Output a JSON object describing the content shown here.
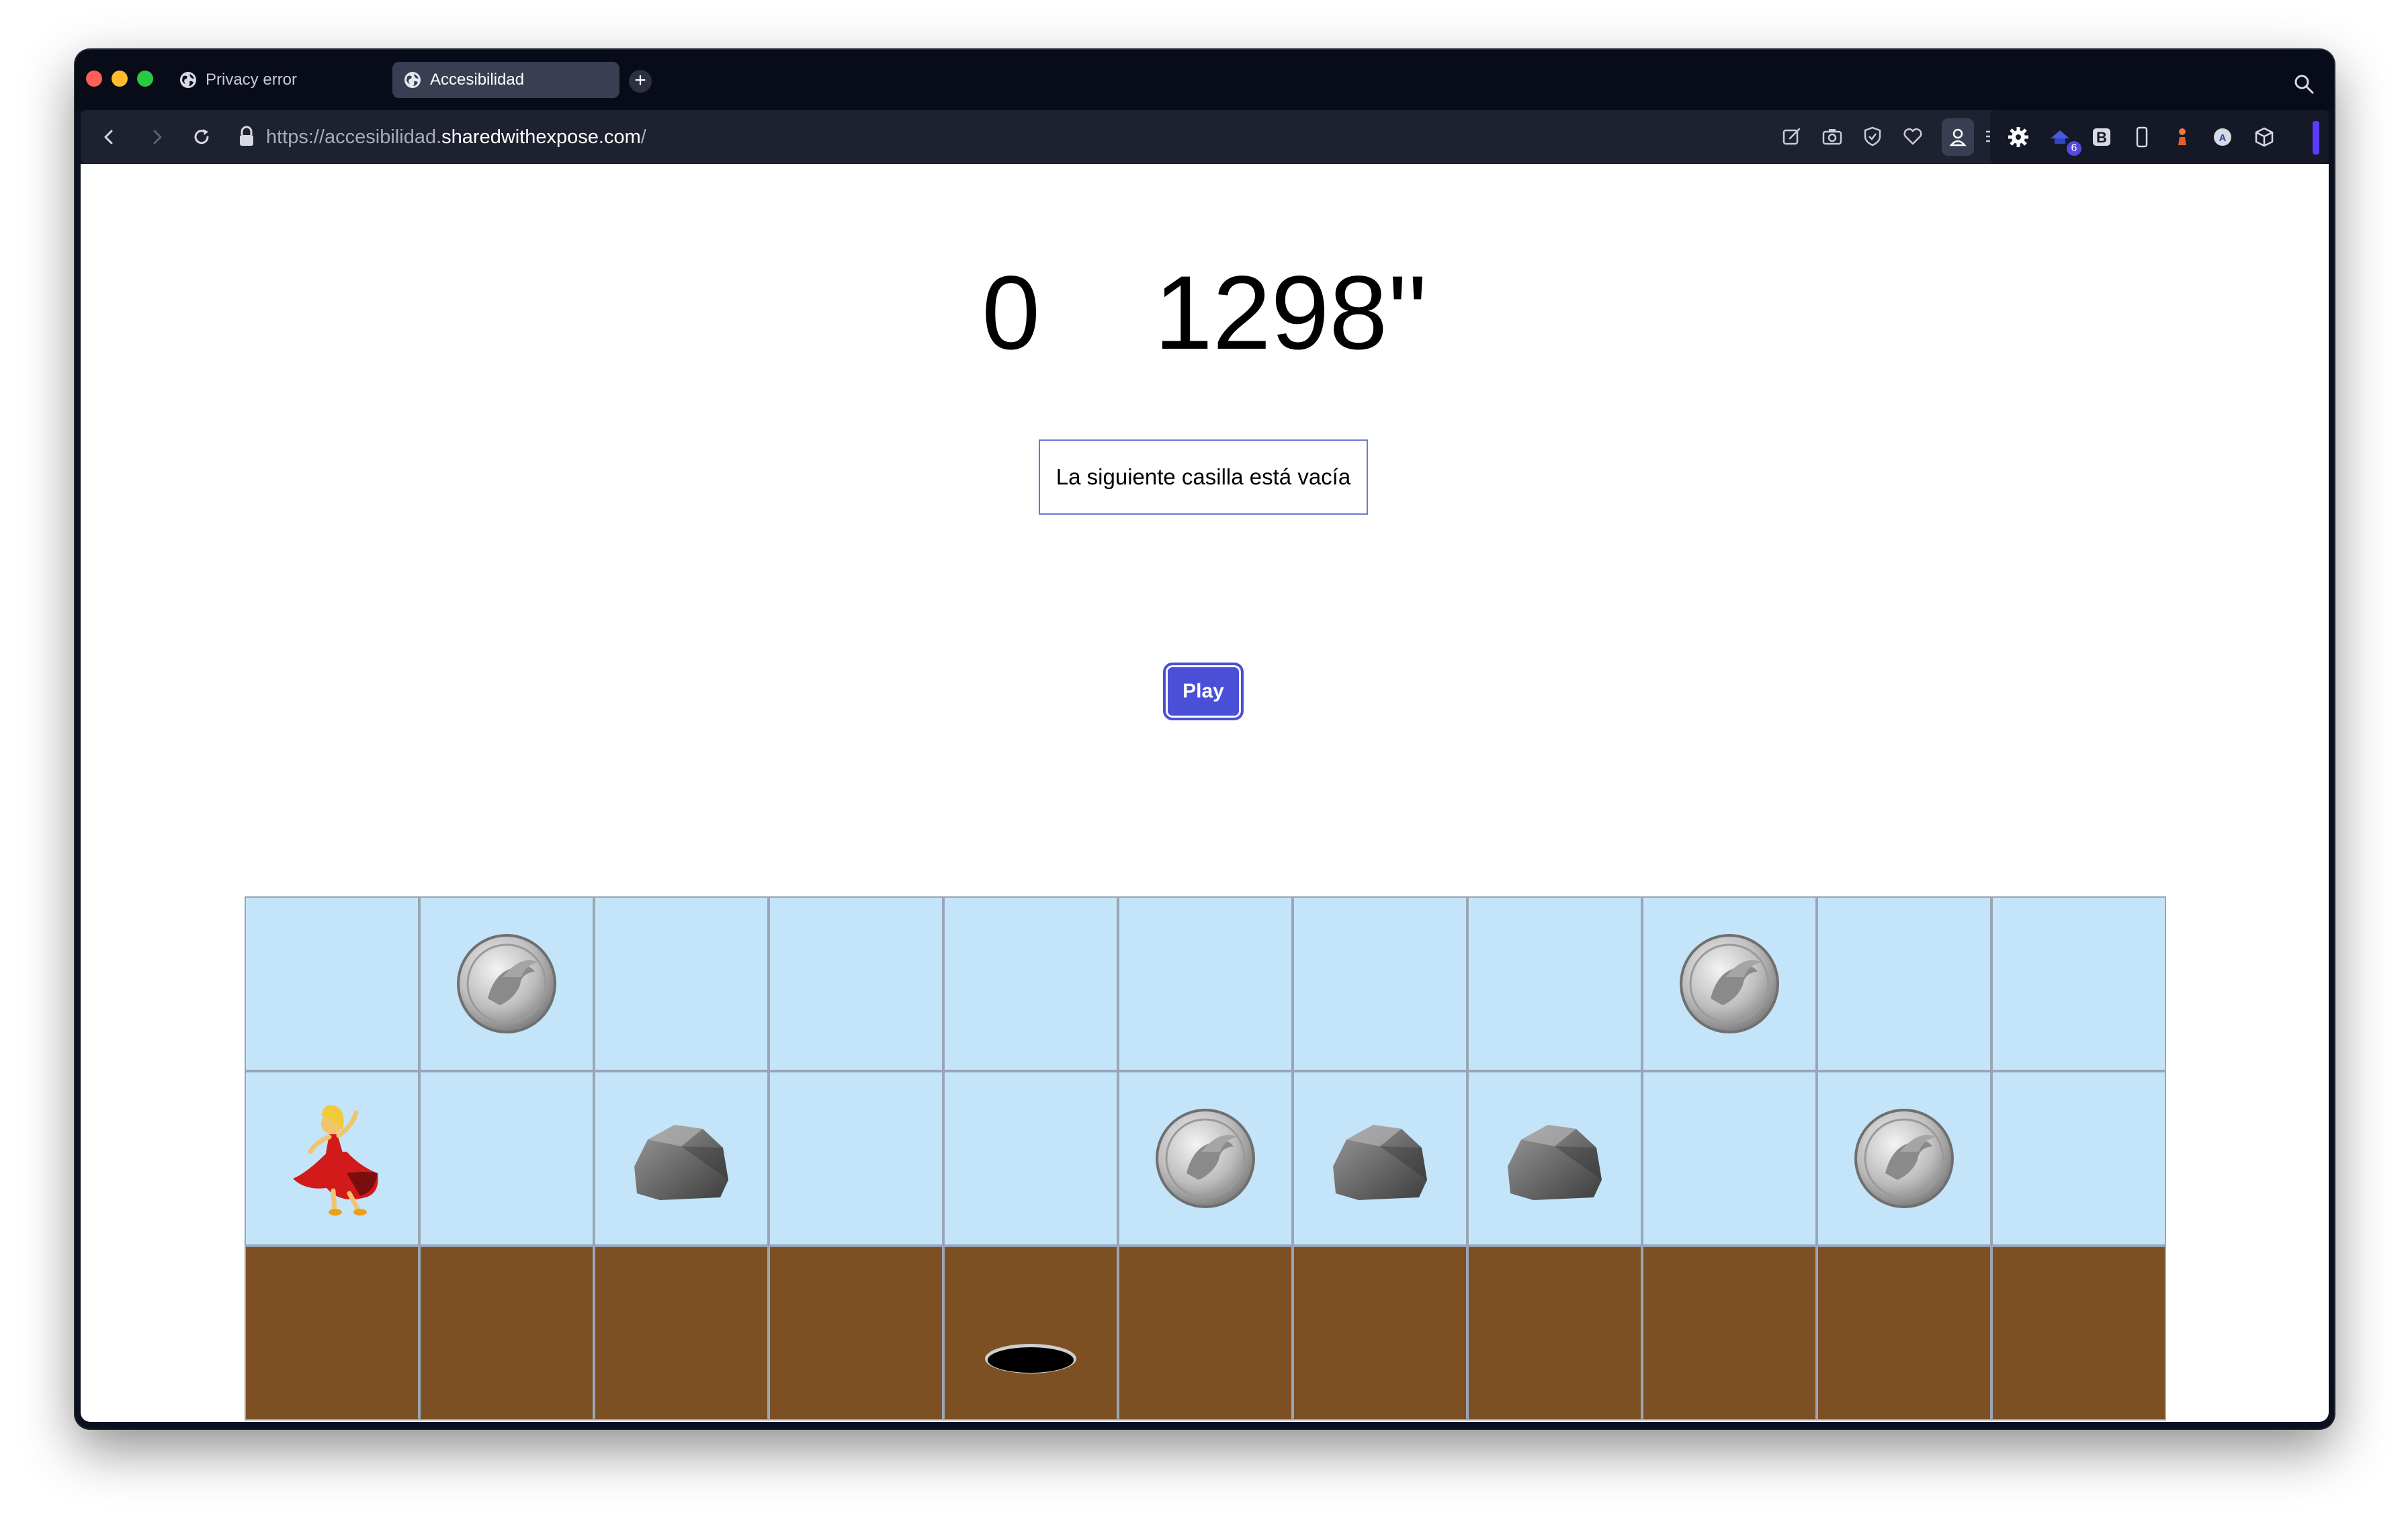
{
  "browser": {
    "tabs": [
      {
        "title": "Privacy error",
        "active": false
      },
      {
        "title": "Accesibilidad",
        "active": true
      }
    ],
    "url_prefix": "https://accesibilidad.",
    "url_domain": "sharedwithexpose.com",
    "url_suffix": "/",
    "extension_badge": "6"
  },
  "game": {
    "coins": "0",
    "time": "1298''",
    "status_message": "La siguiente casilla está vacía",
    "play_label": "Play",
    "colors": {
      "sky": "#c4e5f9",
      "ground": "#7d5024",
      "button": "#4a4fd8"
    },
    "board": [
      [
        "sky",
        "coin",
        "sky",
        "sky",
        "sky",
        "sky",
        "sky",
        "sky",
        "coin",
        "sky",
        "sky"
      ],
      [
        "dancer",
        "sky",
        "rock",
        "sky",
        "sky",
        "coin",
        "rock",
        "rock",
        "sky",
        "coin",
        "sky"
      ],
      [
        "ground",
        "ground",
        "ground",
        "ground",
        "hole",
        "ground",
        "ground",
        "ground",
        "ground",
        "ground",
        "ground"
      ]
    ]
  }
}
